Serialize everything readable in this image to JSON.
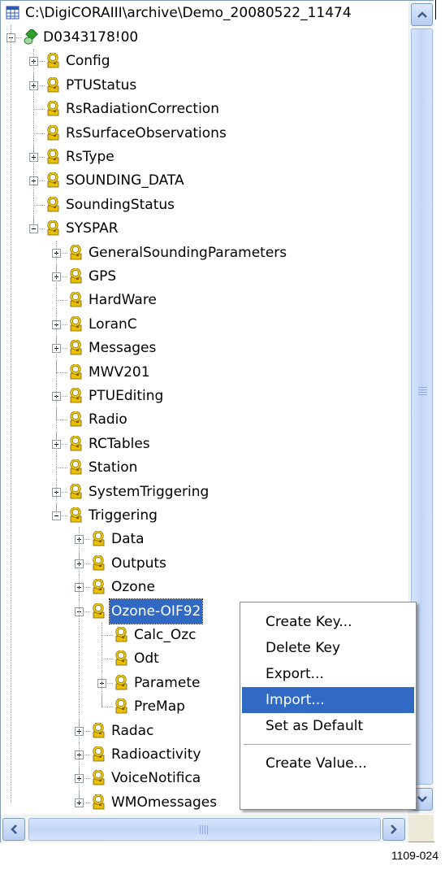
{
  "tree": {
    "root_path": "C:\\DigiCORAIII\\archive\\Demo_20080522_11474",
    "rows": [
      {
        "label": "D0343178!00",
        "icon": "db-node-icon",
        "level": 0,
        "exp": "minus"
      },
      {
        "label": "Config",
        "icon": "key-icon",
        "level": 1,
        "exp": "plus"
      },
      {
        "label": "PTUStatus",
        "icon": "key-icon",
        "level": 1,
        "exp": "plus"
      },
      {
        "label": "RsRadiationCorrection",
        "icon": "key-icon",
        "level": 1,
        "exp": ""
      },
      {
        "label": "RsSurfaceObservations",
        "icon": "key-icon",
        "level": 1,
        "exp": ""
      },
      {
        "label": "RsType",
        "icon": "key-icon",
        "level": 1,
        "exp": "plus"
      },
      {
        "label": "SOUNDING_DATA",
        "icon": "key-icon",
        "level": 1,
        "exp": "plus"
      },
      {
        "label": "SoundingStatus",
        "icon": "key-icon",
        "level": 1,
        "exp": ""
      },
      {
        "label": "SYSPAR",
        "icon": "key-icon",
        "level": 1,
        "exp": "minus"
      },
      {
        "label": "GeneralSoundingParameters",
        "icon": "key-icon",
        "level": 2,
        "exp": "plus"
      },
      {
        "label": "GPS",
        "icon": "key-icon",
        "level": 2,
        "exp": "plus"
      },
      {
        "label": "HardWare",
        "icon": "key-icon",
        "level": 2,
        "exp": ""
      },
      {
        "label": "LoranC",
        "icon": "key-icon",
        "level": 2,
        "exp": "plus"
      },
      {
        "label": "Messages",
        "icon": "key-icon",
        "level": 2,
        "exp": "plus"
      },
      {
        "label": "MWV201",
        "icon": "key-icon",
        "level": 2,
        "exp": ""
      },
      {
        "label": "PTUEditing",
        "icon": "key-icon",
        "level": 2,
        "exp": "plus"
      },
      {
        "label": "Radio",
        "icon": "key-icon",
        "level": 2,
        "exp": ""
      },
      {
        "label": "RCTables",
        "icon": "key-icon",
        "level": 2,
        "exp": "plus"
      },
      {
        "label": "Station",
        "icon": "key-icon",
        "level": 2,
        "exp": ""
      },
      {
        "label": "SystemTriggering",
        "icon": "key-icon",
        "level": 2,
        "exp": "plus"
      },
      {
        "label": "Triggering",
        "icon": "key-icon",
        "level": 2,
        "exp": "minus"
      },
      {
        "label": "Data",
        "icon": "key-icon",
        "level": 3,
        "exp": "plus"
      },
      {
        "label": "Outputs",
        "icon": "key-icon",
        "level": 3,
        "exp": "plus"
      },
      {
        "label": "Ozone",
        "icon": "key-icon",
        "level": 3,
        "exp": "plus"
      },
      {
        "label": "Ozone-OIF92",
        "icon": "key-icon",
        "level": 3,
        "exp": "minus",
        "selected": true
      },
      {
        "label": "Calc_Ozc",
        "icon": "key-icon",
        "level": 4,
        "exp": ""
      },
      {
        "label": "Odt",
        "icon": "key-icon",
        "level": 4,
        "exp": ""
      },
      {
        "label": "Paramete",
        "icon": "key-icon",
        "level": 4,
        "exp": "plus"
      },
      {
        "label": "PreMap",
        "icon": "key-icon",
        "level": 4,
        "exp": ""
      },
      {
        "label": "Radac",
        "icon": "key-icon",
        "level": 3,
        "exp": "plus"
      },
      {
        "label": "Radioactivity",
        "icon": "key-icon",
        "level": 3,
        "exp": "plus"
      },
      {
        "label": "VoiceNotifica",
        "icon": "key-icon",
        "level": 3,
        "exp": "plus"
      },
      {
        "label": "WMOmessages",
        "icon": "key-icon",
        "level": 3,
        "exp": "plus"
      }
    ]
  },
  "context_menu": {
    "items": [
      {
        "label": "Create Key...",
        "highlighted": false
      },
      {
        "label": "Delete Key",
        "highlighted": false
      },
      {
        "label": "Export...",
        "highlighted": false
      },
      {
        "label": "Import...",
        "highlighted": true
      },
      {
        "label": "Set as Default",
        "highlighted": false
      },
      {
        "label": "Create Value...",
        "highlighted": false
      }
    ]
  },
  "figure_id": "1109-024",
  "colors": {
    "selection": "#316ac5",
    "key_icon": "#e0b400",
    "scrollbar": "#c4d6f7"
  }
}
